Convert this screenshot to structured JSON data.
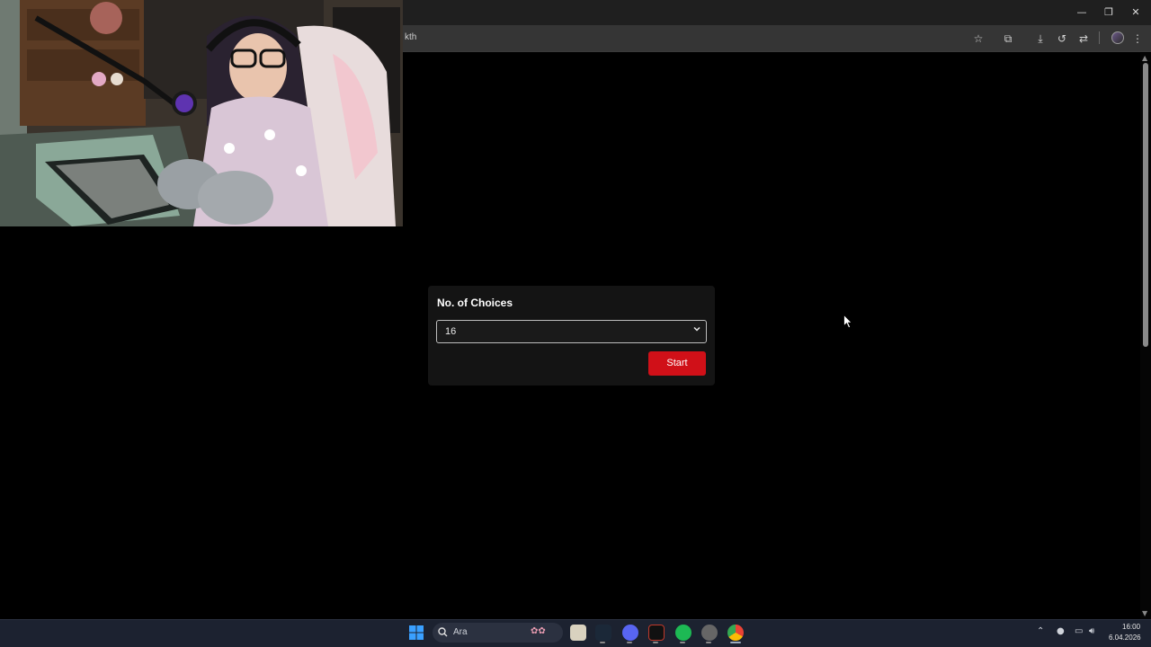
{
  "browser": {
    "url_fragment": "kth",
    "window_controls": {
      "minimize": "—",
      "restore": "❐",
      "close": "✕"
    },
    "toolbar_icons": [
      "star-icon",
      "extensions-icon",
      "download-icon",
      "history-icon",
      "translate-icon",
      "profile-icon",
      "menu-icon"
    ]
  },
  "page": {
    "card": {
      "title": "No. of Choices",
      "select": {
        "selected": "16",
        "options": [
          "16"
        ]
      },
      "start_label": "Start"
    },
    "colors": {
      "background": "#000000",
      "card": "#141414",
      "accent": "#d01018"
    }
  },
  "taskbar": {
    "search_placeholder": "Ara",
    "apps": [
      "windows-start-icon",
      "file-explorer-icon",
      "steam-icon",
      "discord-icon",
      "media-app-icon",
      "spotify-icon",
      "settings-app-icon",
      "chrome-icon"
    ],
    "clock": {
      "time": "16:00",
      "date": "6.04.2026"
    }
  }
}
